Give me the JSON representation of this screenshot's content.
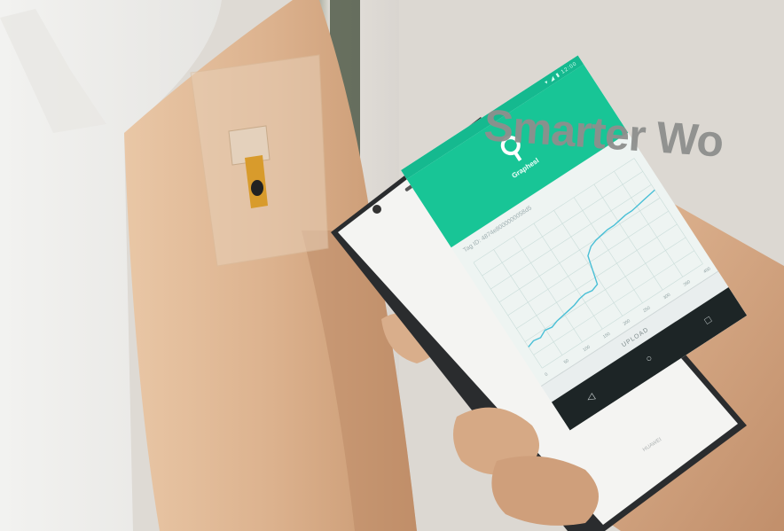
{
  "scene": {
    "wall_text": "Smarter Wo",
    "phone_brand": "HUAWEI"
  },
  "app": {
    "status_icons": "▾ ◢ ▮ 12:00",
    "name": "Graphesl",
    "tag_id": "Tag ID: 4874e8000000058d5",
    "upload_label": "UPLOAD",
    "nav": {
      "back": "◁",
      "home": "○",
      "recent": "□"
    }
  },
  "chart_data": {
    "type": "line",
    "title": "",
    "xlabel": "",
    "ylabel": "",
    "x_tick_labels": [
      "0",
      "50",
      "100",
      "150",
      "200",
      "250",
      "300",
      "350",
      "400"
    ],
    "y_tick_labels": [],
    "series": [
      {
        "values": [
          0.2,
          0.22,
          0.21,
          0.24,
          0.23,
          0.25,
          0.26,
          0.27,
          0.28,
          0.3,
          0.31,
          0.3,
          0.32,
          0.55,
          0.6,
          0.62,
          0.63,
          0.64,
          0.64,
          0.65,
          0.66,
          0.66,
          0.67,
          0.68,
          0.69,
          0.7
        ]
      }
    ],
    "grid": true
  }
}
